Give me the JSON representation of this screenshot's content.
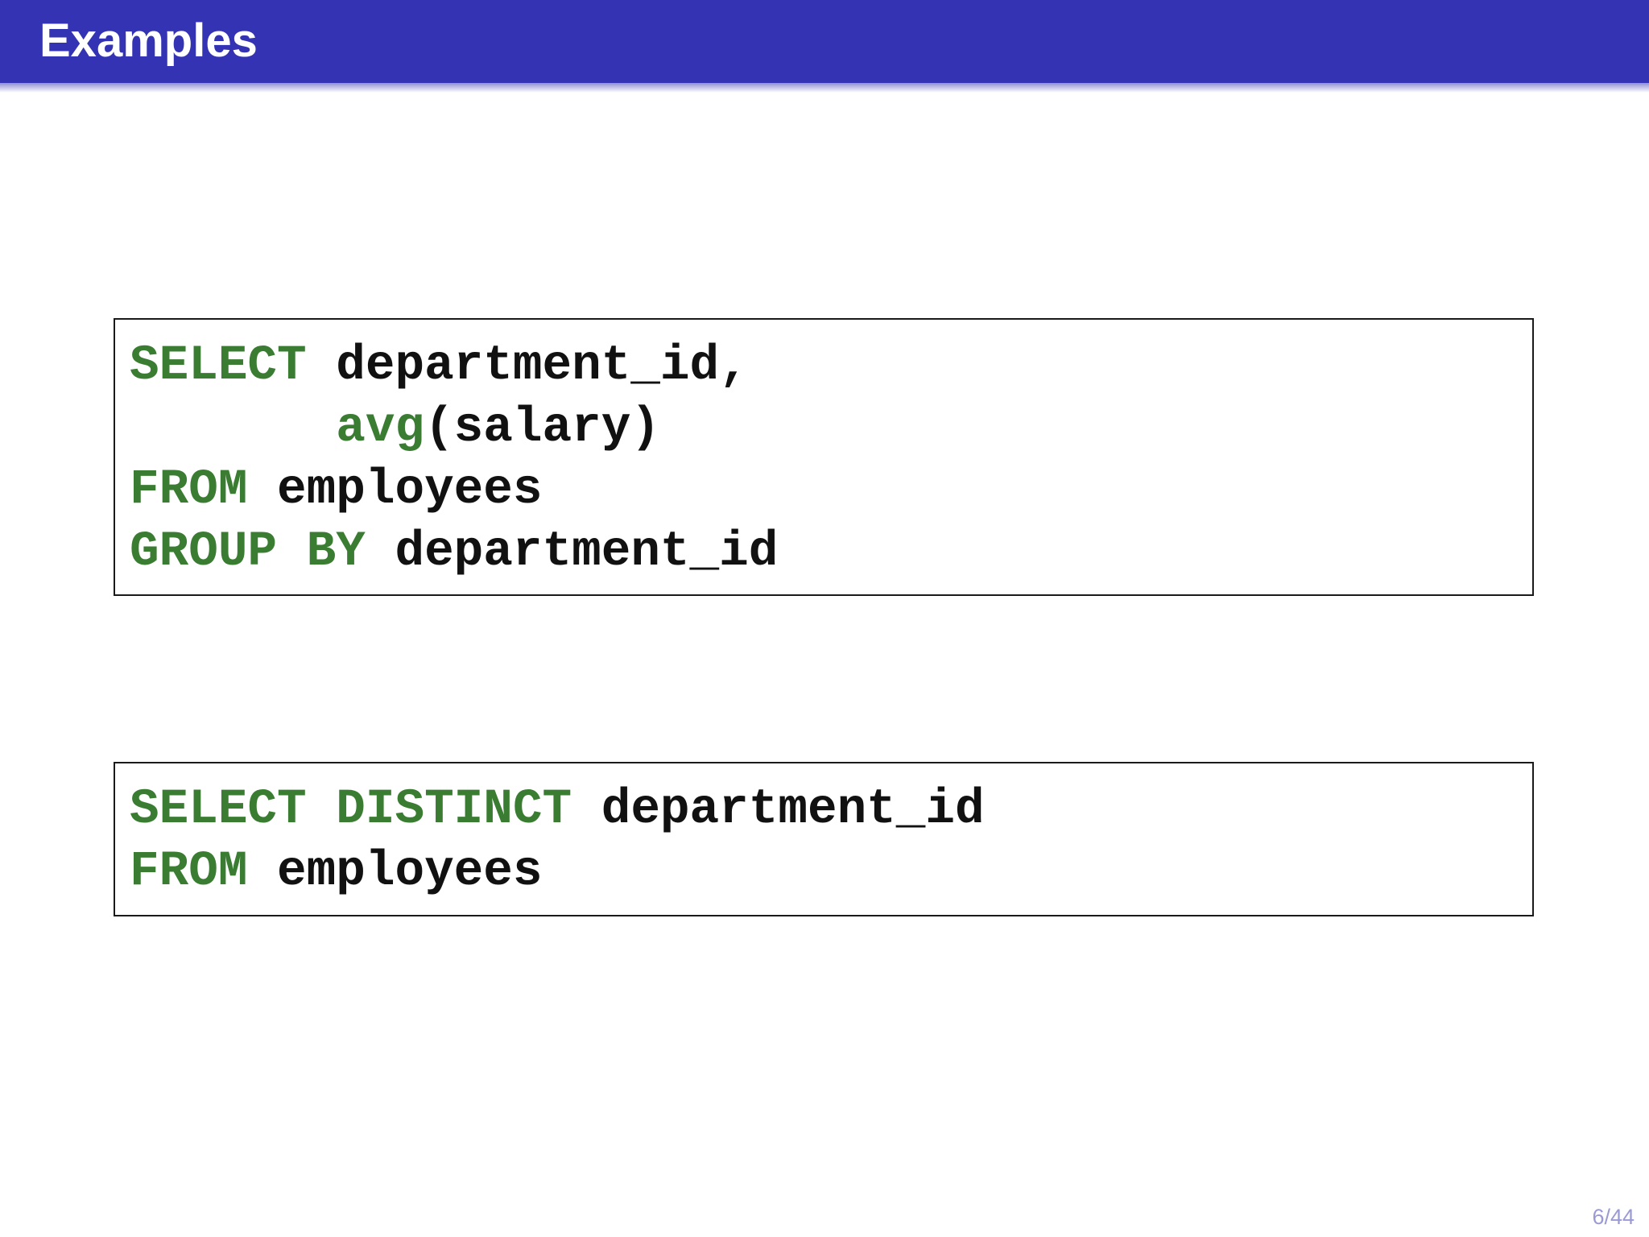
{
  "slide": {
    "title": "Examples",
    "page_number": "6/44"
  },
  "colors": {
    "title_bar": "#3333b3",
    "keyword": "#3a7d32",
    "code_text": "#111111",
    "page_number": "#9a9ad4"
  },
  "code_block_1": {
    "line1": {
      "kw": "SELECT",
      "rest": " department_id,"
    },
    "line2": {
      "indent": "       ",
      "fn": "avg",
      "rest": "(salary)"
    },
    "line3": {
      "kw": "FROM",
      "rest": " employees"
    },
    "line4": {
      "kw1": "GROUP",
      "sp": " ",
      "kw2": "BY",
      "rest": " department_id"
    }
  },
  "code_block_2": {
    "line1": {
      "kw1": "SELECT",
      "sp": " ",
      "kw2": "DISTINCT",
      "rest": " department_id"
    },
    "line2": {
      "kw": "FROM",
      "rest": " employees"
    }
  }
}
